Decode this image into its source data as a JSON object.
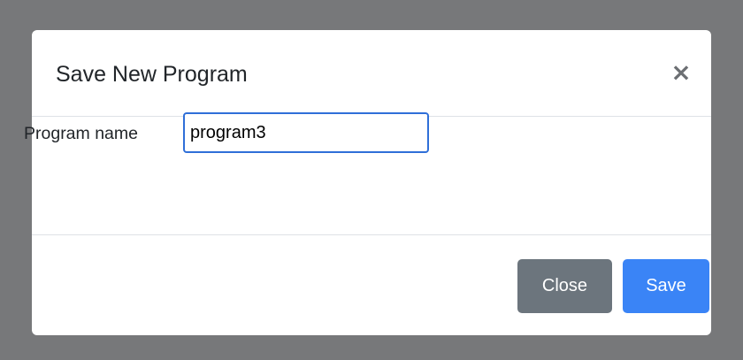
{
  "dialog": {
    "title": "Save New Program",
    "close_icon_glyph": "×",
    "field_label": "Program name",
    "input_value": "program3",
    "close_button_label": "Close",
    "save_button_label": "Save"
  },
  "colors": {
    "backdrop": "#77787a",
    "input_focus_border": "#2f6fd8",
    "close_button": "#6c757d",
    "save_button": "#3a84f6"
  },
  "icons": {
    "close": "close-icon"
  }
}
